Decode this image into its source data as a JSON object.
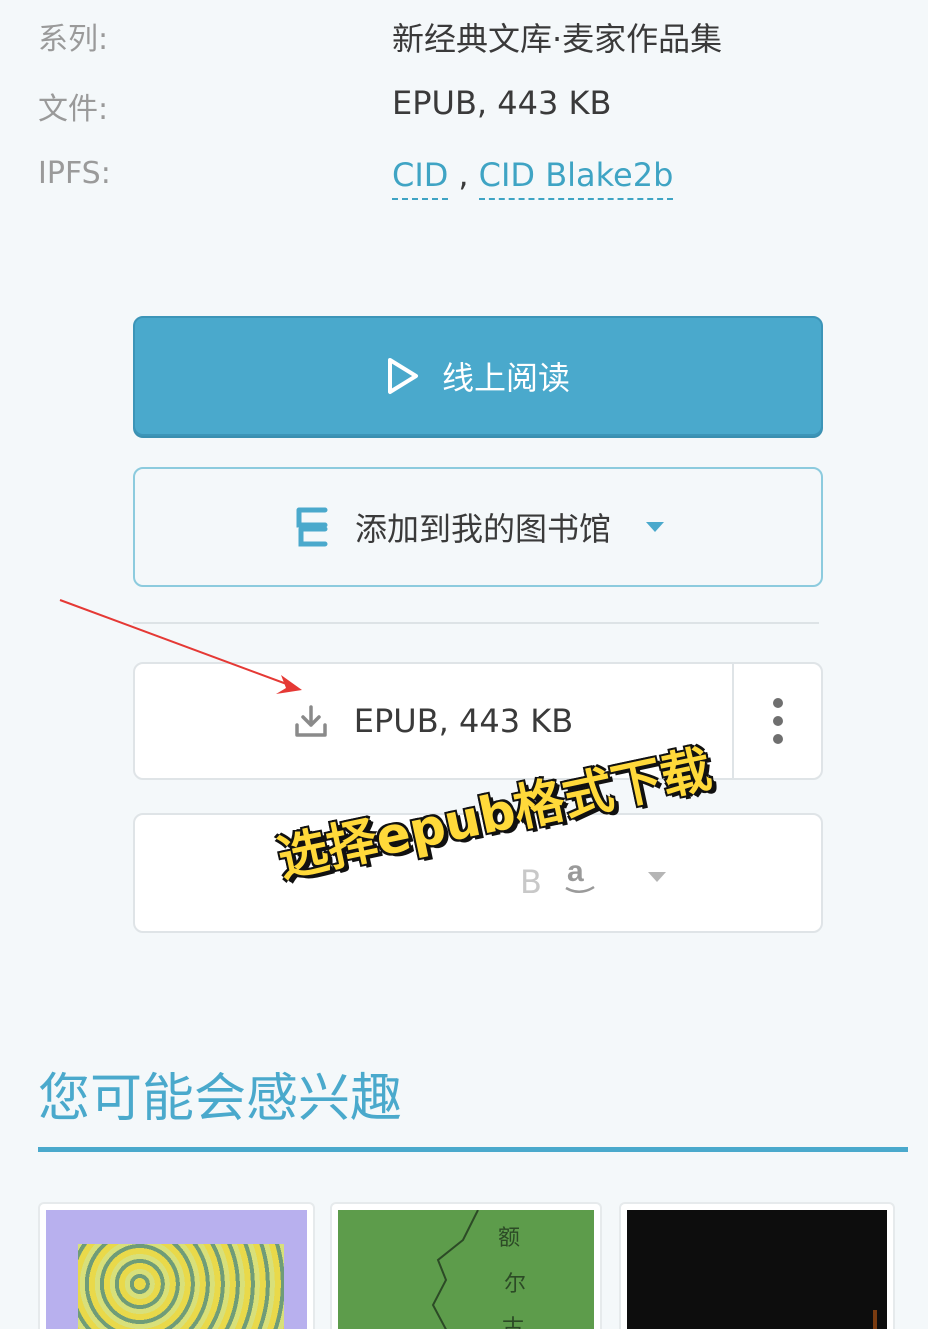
{
  "meta": {
    "series": {
      "label": "系列:",
      "value": "新经典文库·麦家作品集"
    },
    "file": {
      "label": "文件:",
      "value": "EPUB, 443 KB"
    },
    "ipfs": {
      "label": "IPFS:",
      "links": [
        "CID",
        "CID Blake2b"
      ],
      "separator": ","
    }
  },
  "actions": {
    "read_online": "线上阅读",
    "add_to_library": "添加到我的图书馆"
  },
  "download": {
    "label": "EPUB, 443 KB"
  },
  "overlay": {
    "caption": "选择epub格式下载"
  },
  "recommend": {
    "title": "您可能会感兴趣"
  },
  "colors": {
    "accent": "#4aa9cc",
    "link": "#3fa4c4",
    "annotation_arrow": "#e53935",
    "annotation_text": "#ffd93a"
  },
  "icons": [
    "play-icon",
    "library-icon",
    "caret-down-icon",
    "download-icon",
    "more-vertical-icon",
    "amazon-icon"
  ]
}
